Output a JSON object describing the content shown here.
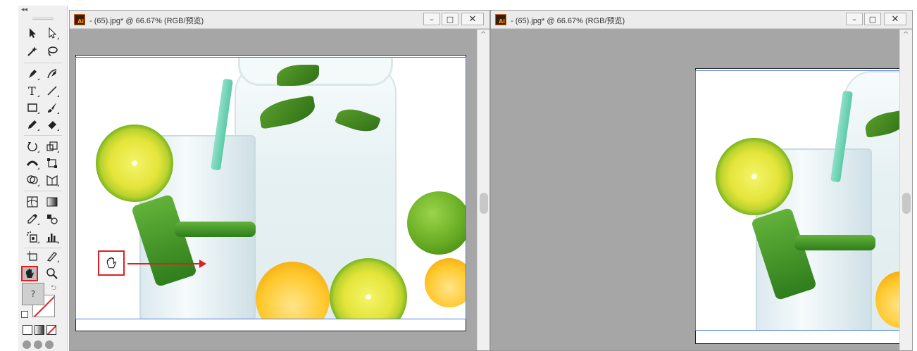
{
  "toolbox": {
    "collapse_label": "◂◂",
    "swatch_fill_label": "?",
    "tools": [
      {
        "name": "selection-tool-icon"
      },
      {
        "name": "direct-selection-tool-icon"
      },
      {
        "name": "magic-wand-tool-icon"
      },
      {
        "name": "lasso-tool-icon"
      },
      {
        "name": "pen-tool-icon"
      },
      {
        "name": "curvature-tool-icon"
      },
      {
        "name": "type-tool-icon"
      },
      {
        "name": "line-segment-tool-icon"
      },
      {
        "name": "rectangle-tool-icon"
      },
      {
        "name": "paintbrush-tool-icon"
      },
      {
        "name": "pencil-tool-icon"
      },
      {
        "name": "eraser-tool-icon"
      },
      {
        "name": "rotate-tool-icon"
      },
      {
        "name": "scale-tool-icon"
      },
      {
        "name": "width-tool-icon"
      },
      {
        "name": "free-transform-tool-icon"
      },
      {
        "name": "shape-builder-tool-icon"
      },
      {
        "name": "perspective-grid-tool-icon"
      },
      {
        "name": "mesh-tool-icon"
      },
      {
        "name": "gradient-tool-icon"
      },
      {
        "name": "eyedropper-tool-icon"
      },
      {
        "name": "blend-tool-icon"
      },
      {
        "name": "symbol-sprayer-tool-icon"
      },
      {
        "name": "column-graph-tool-icon"
      },
      {
        "name": "artboard-tool-icon"
      },
      {
        "name": "slice-tool-icon"
      },
      {
        "name": "hand-tool-icon",
        "active": true
      },
      {
        "name": "zoom-tool-icon"
      }
    ],
    "highlight_color": "#e02020"
  },
  "left_window": {
    "title": "- (65).jpg* @ 66.67% (RGB/预览)",
    "minimize_label": "–",
    "maximize_label": "□",
    "close_label": "✕"
  },
  "right_window": {
    "title": "- (65).jpg* @ 66.67% (RGB/预览)",
    "minimize_label": "–",
    "maximize_label": "□",
    "close_label": "✕"
  },
  "annotation": {
    "cursor_icon": "hand-cursor-icon",
    "arrow_direction": "right",
    "color": "#e02020"
  },
  "colors": {
    "canvas_bg": "#a6a6a6",
    "artboard_guide": "#4a7bdc",
    "titlebar_bg": "#ececec"
  }
}
